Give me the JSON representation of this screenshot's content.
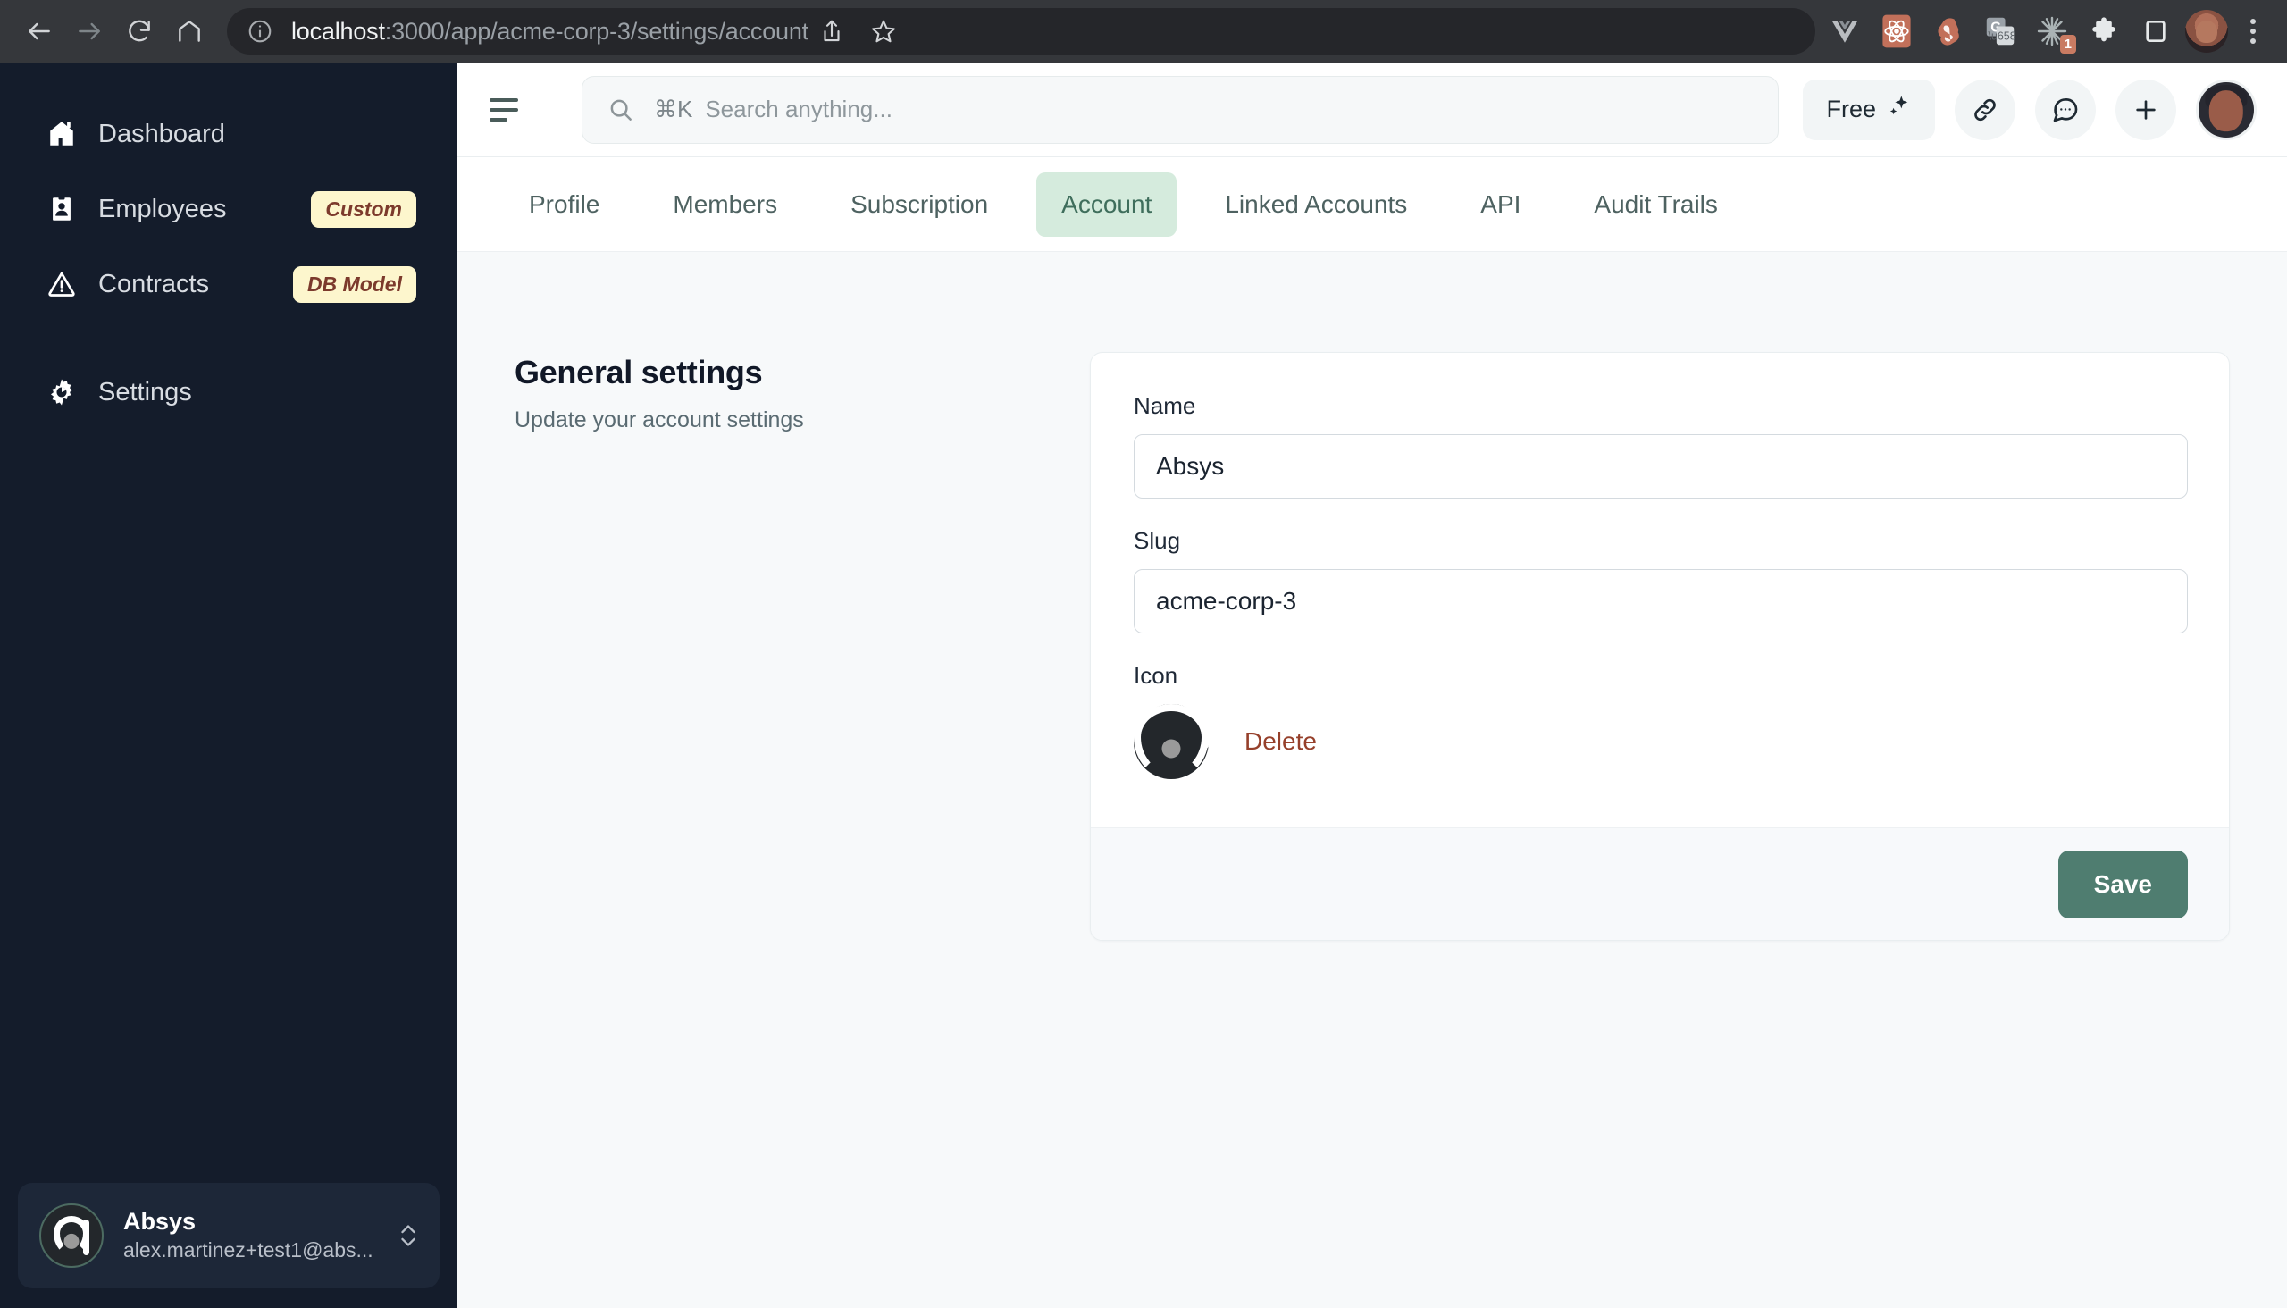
{
  "browser": {
    "nav": {
      "back": "back-arrow",
      "forward": "forward-arrow",
      "reload": "reload",
      "home": "home"
    },
    "url": {
      "host": "localhost",
      "path": ":3000/app/acme-corp-3/settings/account",
      "full": "localhost:3000/app/acme-corp-3/settings/account",
      "info_icon": "info-circle-icon"
    },
    "url_actions": [
      "share-icon",
      "bookmark-star-icon"
    ],
    "extensions": [
      {
        "name": "vue-devtools-icon",
        "glyph": "V"
      },
      {
        "name": "react-devtools-icon",
        "glyph": "⚛"
      },
      {
        "name": "svelte-devtools-icon",
        "glyph": "S"
      },
      {
        "name": "google-translate-icon",
        "glyph": "G"
      },
      {
        "name": "starburst-extension-icon",
        "glyph": "✳",
        "badge": "1"
      },
      {
        "name": "extensions-puzzle-icon",
        "glyph": "❖"
      },
      {
        "name": "side-panel-icon",
        "glyph": "▭"
      }
    ],
    "profile": "chrome-profile-avatar",
    "menu": "chrome-three-dot-menu"
  },
  "sidebar": {
    "items": [
      {
        "label": "Dashboard",
        "icon": "home-icon",
        "badge": null
      },
      {
        "label": "Employees",
        "icon": "id-badge-icon",
        "badge": "Custom"
      },
      {
        "label": "Contracts",
        "icon": "warning-triangle-icon",
        "badge": "DB Model"
      },
      {
        "label": "Settings",
        "icon": "gear-icon",
        "badge": null
      }
    ],
    "footer": {
      "org_name": "Absys",
      "org_email": "alex.martinez+test1@abs...",
      "avatar": "absys-logo-avatar",
      "switcher_icon": "chevron-up-down-icon"
    }
  },
  "topbar": {
    "collapse_icon": "sidebar-collapse-icon",
    "search": {
      "icon": "search-icon",
      "shortcut": "⌘K",
      "placeholder": "Search anything..."
    },
    "plan_label": "Free",
    "plan_icon": "sparkles-icon",
    "actions": [
      {
        "name": "link-icon"
      },
      {
        "name": "chat-bubble-icon"
      },
      {
        "name": "plus-icon"
      }
    ],
    "avatar": "user-avatar"
  },
  "tabs": [
    {
      "label": "Profile",
      "active": false
    },
    {
      "label": "Members",
      "active": false
    },
    {
      "label": "Subscription",
      "active": false
    },
    {
      "label": "Account",
      "active": true
    },
    {
      "label": "Linked Accounts",
      "active": false
    },
    {
      "label": "API",
      "active": false
    },
    {
      "label": "Audit Trails",
      "active": false
    }
  ],
  "content": {
    "section_title": "General settings",
    "section_subtitle": "Update your account settings",
    "form": {
      "name_label": "Name",
      "name_value": "Absys",
      "slug_label": "Slug",
      "slug_value": "acme-corp-3",
      "icon_label": "Icon",
      "icon_preview": "absys-logo-icon",
      "delete_label": "Delete",
      "save_label": "Save"
    }
  },
  "colors": {
    "sidebar_bg": "#141c2b",
    "badge_bg": "#fdf6cd",
    "badge_text": "#7c3a2c",
    "active_tab_bg": "#d5ebdd",
    "active_tab_text": "#3f6e5c",
    "save_button_bg": "#4f7d70",
    "delete_link": "#96402b",
    "page_bg": "#f7f9fa"
  }
}
